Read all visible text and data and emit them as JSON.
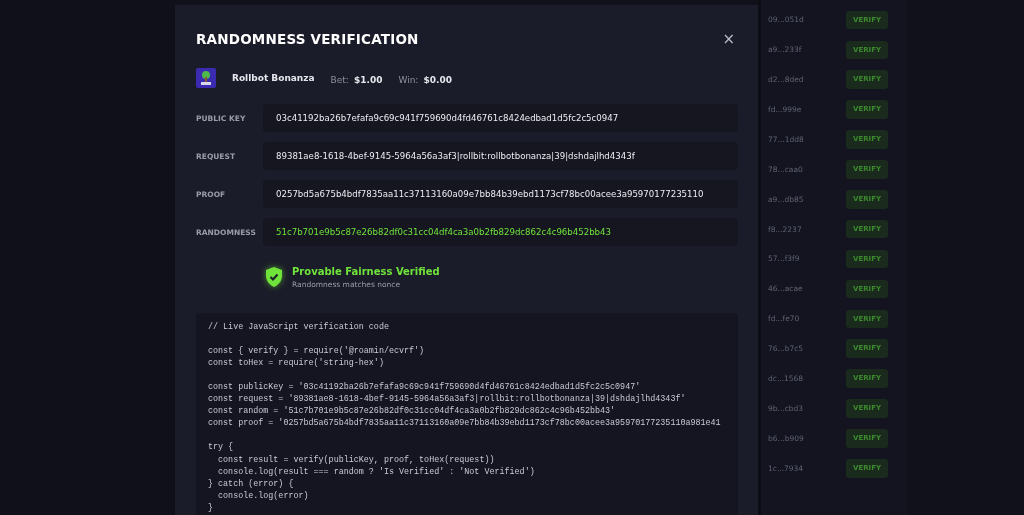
{
  "modal": {
    "title": "RANDOMNESS VERIFICATION",
    "close": "×",
    "game": {
      "name": "Rollbot Bonanza",
      "bet_label": "Bet:",
      "bet": "$1.00",
      "win_label": "Win:",
      "win": "$0.00"
    },
    "fields": [
      {
        "label": "PUBLIC KEY",
        "value": "03c41192ba26b7efafa9c69c941f759690d4fd46761c8424edbad1d5fc2c5c0947",
        "highlight": false
      },
      {
        "label": "REQUEST",
        "value": "89381ae8-1618-4bef-9145-5964a56a3af3|rollbit:rollbotbonanza|39|dshdajlhd4343f",
        "highlight": false
      },
      {
        "label": "PROOF",
        "value": "0257bd5a675b4bdf7835aa11c37113160a09e7bb84b39ebd1173cf78bc00acee3a95970177235110",
        "highlight": false
      },
      {
        "label": "RANDOMNESS",
        "value": "51c7b701e9b5c87e26b82df0c31cc04df4ca3a0b2fb829dc862c4c96b452bb43",
        "highlight": true
      }
    ],
    "status": {
      "verified": true,
      "title": "Provable Fairness Verified",
      "subtitle": "Randomness matches nonce"
    },
    "code": {
      "comment": "// Live JavaScript verification code",
      "groups": [
        [
          "const { verify } = require('@roamin/ecvrf')",
          "const toHex = require('string-hex')"
        ],
        [
          "const publicKey = '03c41192ba26b7efafa9c69c941f759690d4fd46761c8424edbad1d5fc2c5c0947'",
          "const request = '89381ae8-1618-4bef-9145-5964a56a3af3|rollbit:rollbotbonanza|39|dshdajlhd4343f'",
          "const random = '51c7b701e9b5c87e26b82df0c31cc04df4ca3a0b2fb829dc862c4c96b452bb43'",
          "const proof = '0257bd5a675b4bdf7835aa11c37113160a09e7bb84b39ebd1173cf78bc00acee3a95970177235110a981e41"
        ],
        [
          "try {",
          "  const result = verify(publicKey, proof, toHex(request))",
          "  console.log(result === random ? 'Is Verified' : 'Not Verified')",
          "} catch (error) {",
          "  console.log(error)",
          "}"
        ]
      ]
    }
  },
  "background_list": [
    {
      "hash": "09...051d",
      "action": "VERIFY"
    },
    {
      "hash": "a9...233f",
      "action": "VERIFY"
    },
    {
      "hash": "d2...8ded",
      "action": "VERIFY"
    },
    {
      "hash": "fd...999e",
      "action": "VERIFY"
    },
    {
      "hash": "77...1dd8",
      "action": "VERIFY"
    },
    {
      "hash": "78...caa0",
      "action": "VERIFY"
    },
    {
      "hash": "a9...db85",
      "action": "VERIFY"
    },
    {
      "hash": "f8...2237",
      "action": "VERIFY"
    },
    {
      "hash": "57...f3f9",
      "action": "VERIFY"
    },
    {
      "hash": "46...acae",
      "action": "VERIFY"
    },
    {
      "hash": "fd...fe70",
      "action": "VERIFY"
    },
    {
      "hash": "76...b7c5",
      "action": "VERIFY"
    },
    {
      "hash": "dc...1568",
      "action": "VERIFY"
    },
    {
      "hash": "9b...cbd3",
      "action": "VERIFY"
    },
    {
      "hash": "b6...b909",
      "action": "VERIFY"
    },
    {
      "hash": "1c...7934",
      "action": "VERIFY"
    }
  ]
}
